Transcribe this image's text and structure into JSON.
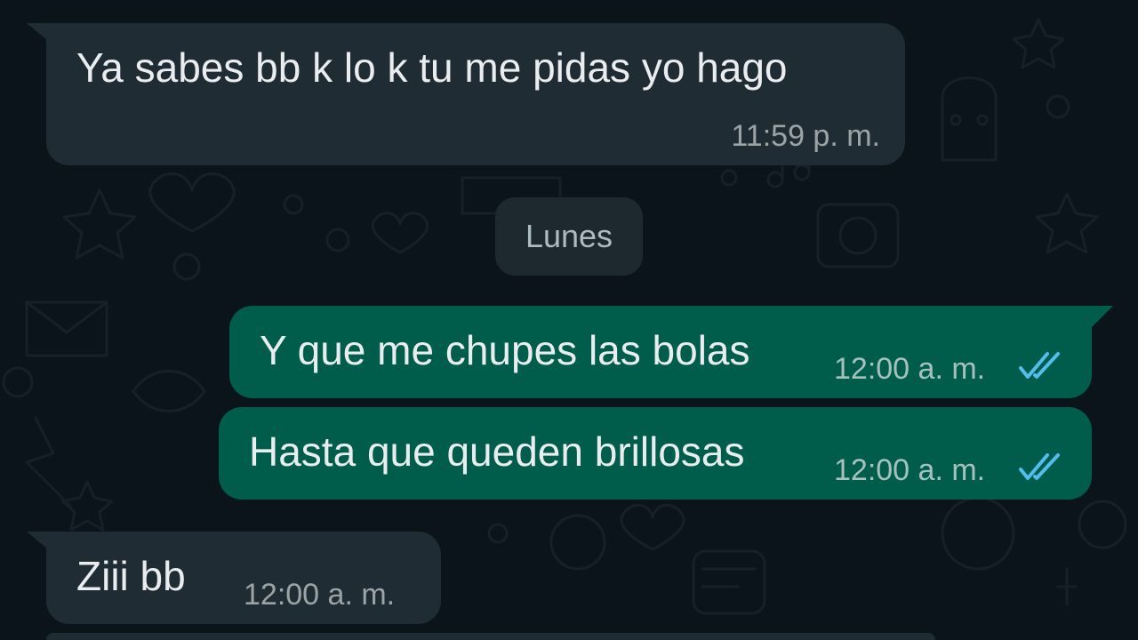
{
  "theme": {
    "background": "#0b141a",
    "incoming_bubble": "#202c33",
    "outgoing_bubble": "#005c4b",
    "text": "#e9edef",
    "read_ticks": "#53bdeb"
  },
  "day_separator": "Lunes",
  "messages": [
    {
      "direction": "incoming",
      "text": "Ya sabes bb k lo k tu me pidas yo hago",
      "time": "11:59 p. m."
    },
    {
      "direction": "outgoing",
      "text": "Y que me chupes las bolas",
      "time": "12:00 a. m.",
      "status": "read",
      "status_icon": "double-check-icon"
    },
    {
      "direction": "outgoing",
      "text": "Hasta que queden brillosas",
      "time": "12:00 a. m.",
      "status": "read",
      "status_icon": "double-check-icon"
    },
    {
      "direction": "incoming",
      "text": "Ziii bb",
      "time": "12:00 a. m."
    }
  ]
}
